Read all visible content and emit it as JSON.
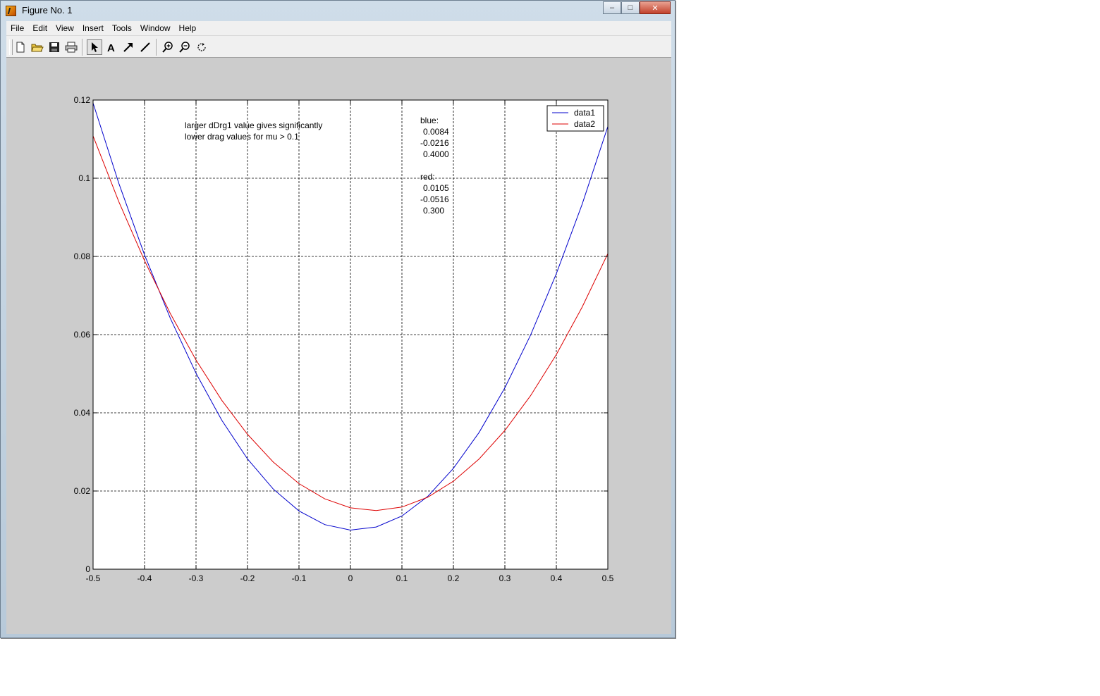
{
  "window": {
    "title": "Figure No. 1",
    "buttons": {
      "minimize": "–",
      "maximize": "□",
      "close": "✕"
    }
  },
  "menu": [
    "File",
    "Edit",
    "View",
    "Insert",
    "Tools",
    "Window",
    "Help"
  ],
  "toolbar": {
    "buttons": [
      {
        "name": "new-figure-icon"
      },
      {
        "name": "open-file-icon"
      },
      {
        "name": "save-icon"
      },
      {
        "name": "print-icon"
      },
      {
        "name": "edit-plot-arrow-icon",
        "active": true
      },
      {
        "name": "insert-text-icon"
      },
      {
        "name": "insert-arrow-icon"
      },
      {
        "name": "insert-line-icon"
      },
      {
        "name": "zoom-in-icon"
      },
      {
        "name": "zoom-out-icon"
      },
      {
        "name": "rotate-3d-icon"
      }
    ]
  },
  "annotations": {
    "note_line1": "larger dDrg1 value gives significantly",
    "note_line2": "lower drag values for mu > 0.1",
    "params": [
      "blue:",
      "0.0084",
      "-0.0216",
      "0.4000",
      "",
      "red:",
      "0.0105",
      "-0.0516",
      "0.300"
    ]
  },
  "chart_data": {
    "type": "line",
    "title": "",
    "xlabel": "",
    "ylabel": "",
    "xlim": [
      -0.5,
      0.5
    ],
    "ylim": [
      0,
      0.12
    ],
    "xticks": [
      "-0.5",
      "-0.4",
      "-0.3",
      "-0.2",
      "-0.1",
      "0",
      "0.1",
      "0.2",
      "0.3",
      "0.4",
      "0.5"
    ],
    "yticks": [
      "0",
      "0.02",
      "0.04",
      "0.06",
      "0.08",
      "0.1",
      "0.12"
    ],
    "grid": true,
    "legend_position": "top-right",
    "series": [
      {
        "name": "data1",
        "color": "#0000cc",
        "x": [
          -0.5,
          -0.45,
          -0.4,
          -0.35,
          -0.3,
          -0.25,
          -0.2,
          -0.15,
          -0.1,
          -0.05,
          0,
          0.05,
          0.1,
          0.15,
          0.2,
          0.25,
          0.3,
          0.35,
          0.4,
          0.45,
          0.5
        ],
        "y": [
          0.1192,
          0.0987,
          0.0804,
          0.0642,
          0.0501,
          0.0381,
          0.0282,
          0.0205,
          0.0149,
          0.0114,
          0.01,
          0.0108,
          0.0136,
          0.0186,
          0.0258,
          0.035,
          0.0464,
          0.0599,
          0.0756,
          0.0933,
          0.1132
        ]
      },
      {
        "name": "data2",
        "color": "#dd0000",
        "x": [
          -0.5,
          -0.45,
          -0.4,
          -0.35,
          -0.3,
          -0.25,
          -0.2,
          -0.15,
          -0.1,
          -0.05,
          0,
          0.05,
          0.1,
          0.15,
          0.2,
          0.25,
          0.3,
          0.35,
          0.4,
          0.45,
          0.5
        ],
        "y": [
          0.1108,
          0.094,
          0.0789,
          0.0654,
          0.0535,
          0.0432,
          0.0345,
          0.0274,
          0.0219,
          0.018,
          0.0157,
          0.015,
          0.0159,
          0.0184,
          0.0225,
          0.0282,
          0.0355,
          0.0444,
          0.0549,
          0.067,
          0.0807
        ]
      }
    ]
  }
}
